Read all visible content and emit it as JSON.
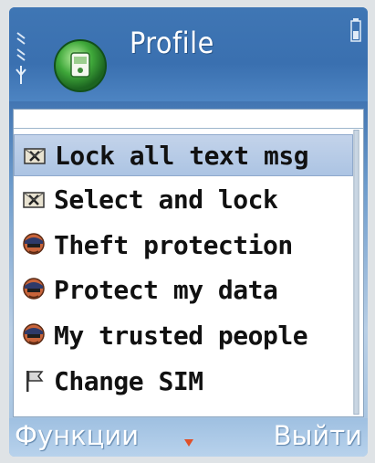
{
  "header": {
    "title": "Profile"
  },
  "menu": {
    "items": [
      {
        "label": "Lock all text msg",
        "icon": "lock-message-icon",
        "selected": true
      },
      {
        "label": "Select and lock",
        "icon": "lock-message-icon",
        "selected": false
      },
      {
        "label": "Theft protection",
        "icon": "agent-icon",
        "selected": false
      },
      {
        "label": "Protect my data",
        "icon": "agent-icon",
        "selected": false
      },
      {
        "label": "My trusted people",
        "icon": "agent-icon",
        "selected": false
      },
      {
        "label": "Change SIM",
        "icon": "flag-icon",
        "selected": false
      }
    ]
  },
  "softkeys": {
    "left": "Функции",
    "right": "Выйти"
  },
  "colors": {
    "header": "#3f76b4",
    "selection": "#b4c8e4",
    "text": "#111111"
  }
}
